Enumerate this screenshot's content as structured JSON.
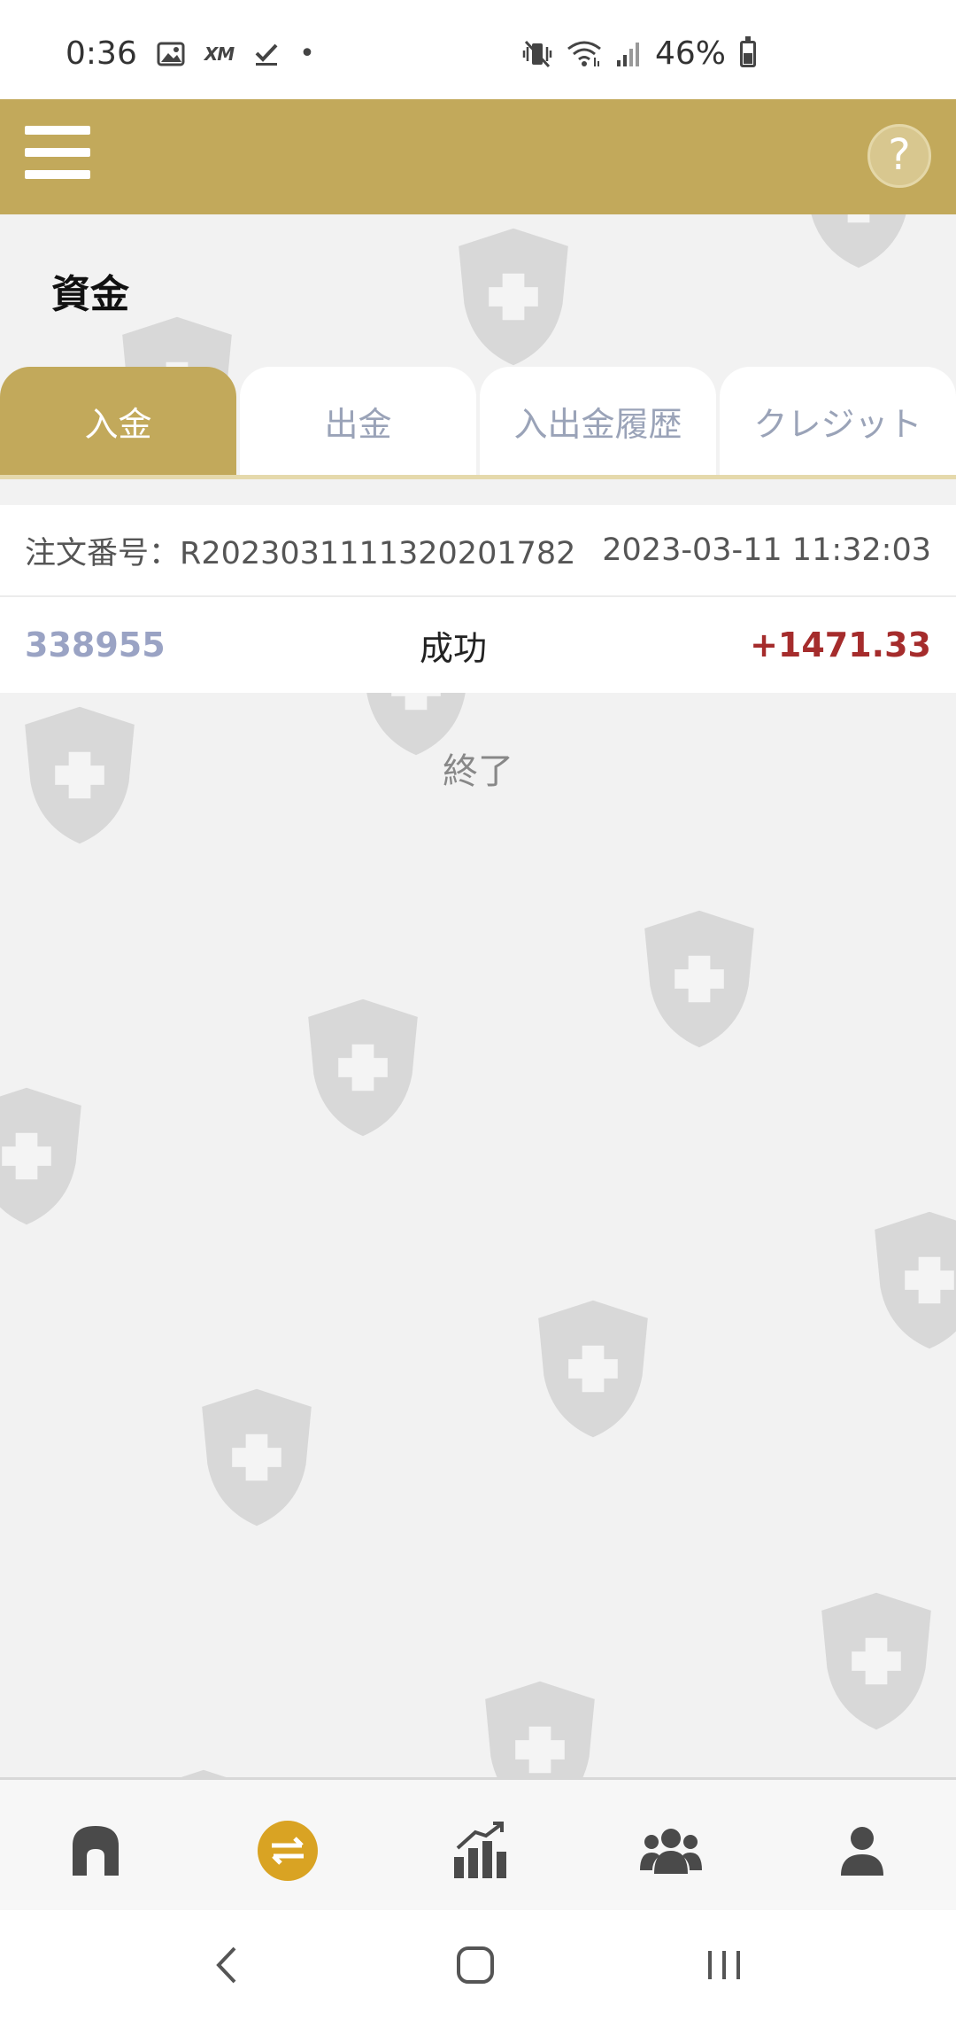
{
  "status_bar": {
    "time": "0:36",
    "battery": "46%",
    "xm_label": "XM",
    "dot": "•"
  },
  "header": {
    "menu_icon": "hamburger-icon",
    "help_label": "?"
  },
  "page": {
    "title": "資金"
  },
  "tabs": [
    {
      "label": "入金",
      "active": true
    },
    {
      "label": "出金",
      "active": false
    },
    {
      "label": "入出金履歴",
      "active": false
    },
    {
      "label": "クレジット",
      "active": false
    }
  ],
  "order": {
    "order_number": "注文番号：R2023031111320201782",
    "datetime": "2023-03-11 11:32:03",
    "account": "338955",
    "status": "成功",
    "amount": "+1471.33"
  },
  "end_label": "終了",
  "bottom_nav": [
    {
      "icon": "home-icon"
    },
    {
      "icon": "transfer-icon",
      "active": true
    },
    {
      "icon": "chart-icon"
    },
    {
      "icon": "community-icon"
    },
    {
      "icon": "profile-icon"
    }
  ],
  "colors": {
    "brand": "#c2a95b",
    "accent": "#d9a323",
    "amount": "#a52c2c",
    "inactive_tab_text": "#9aa3b8"
  }
}
